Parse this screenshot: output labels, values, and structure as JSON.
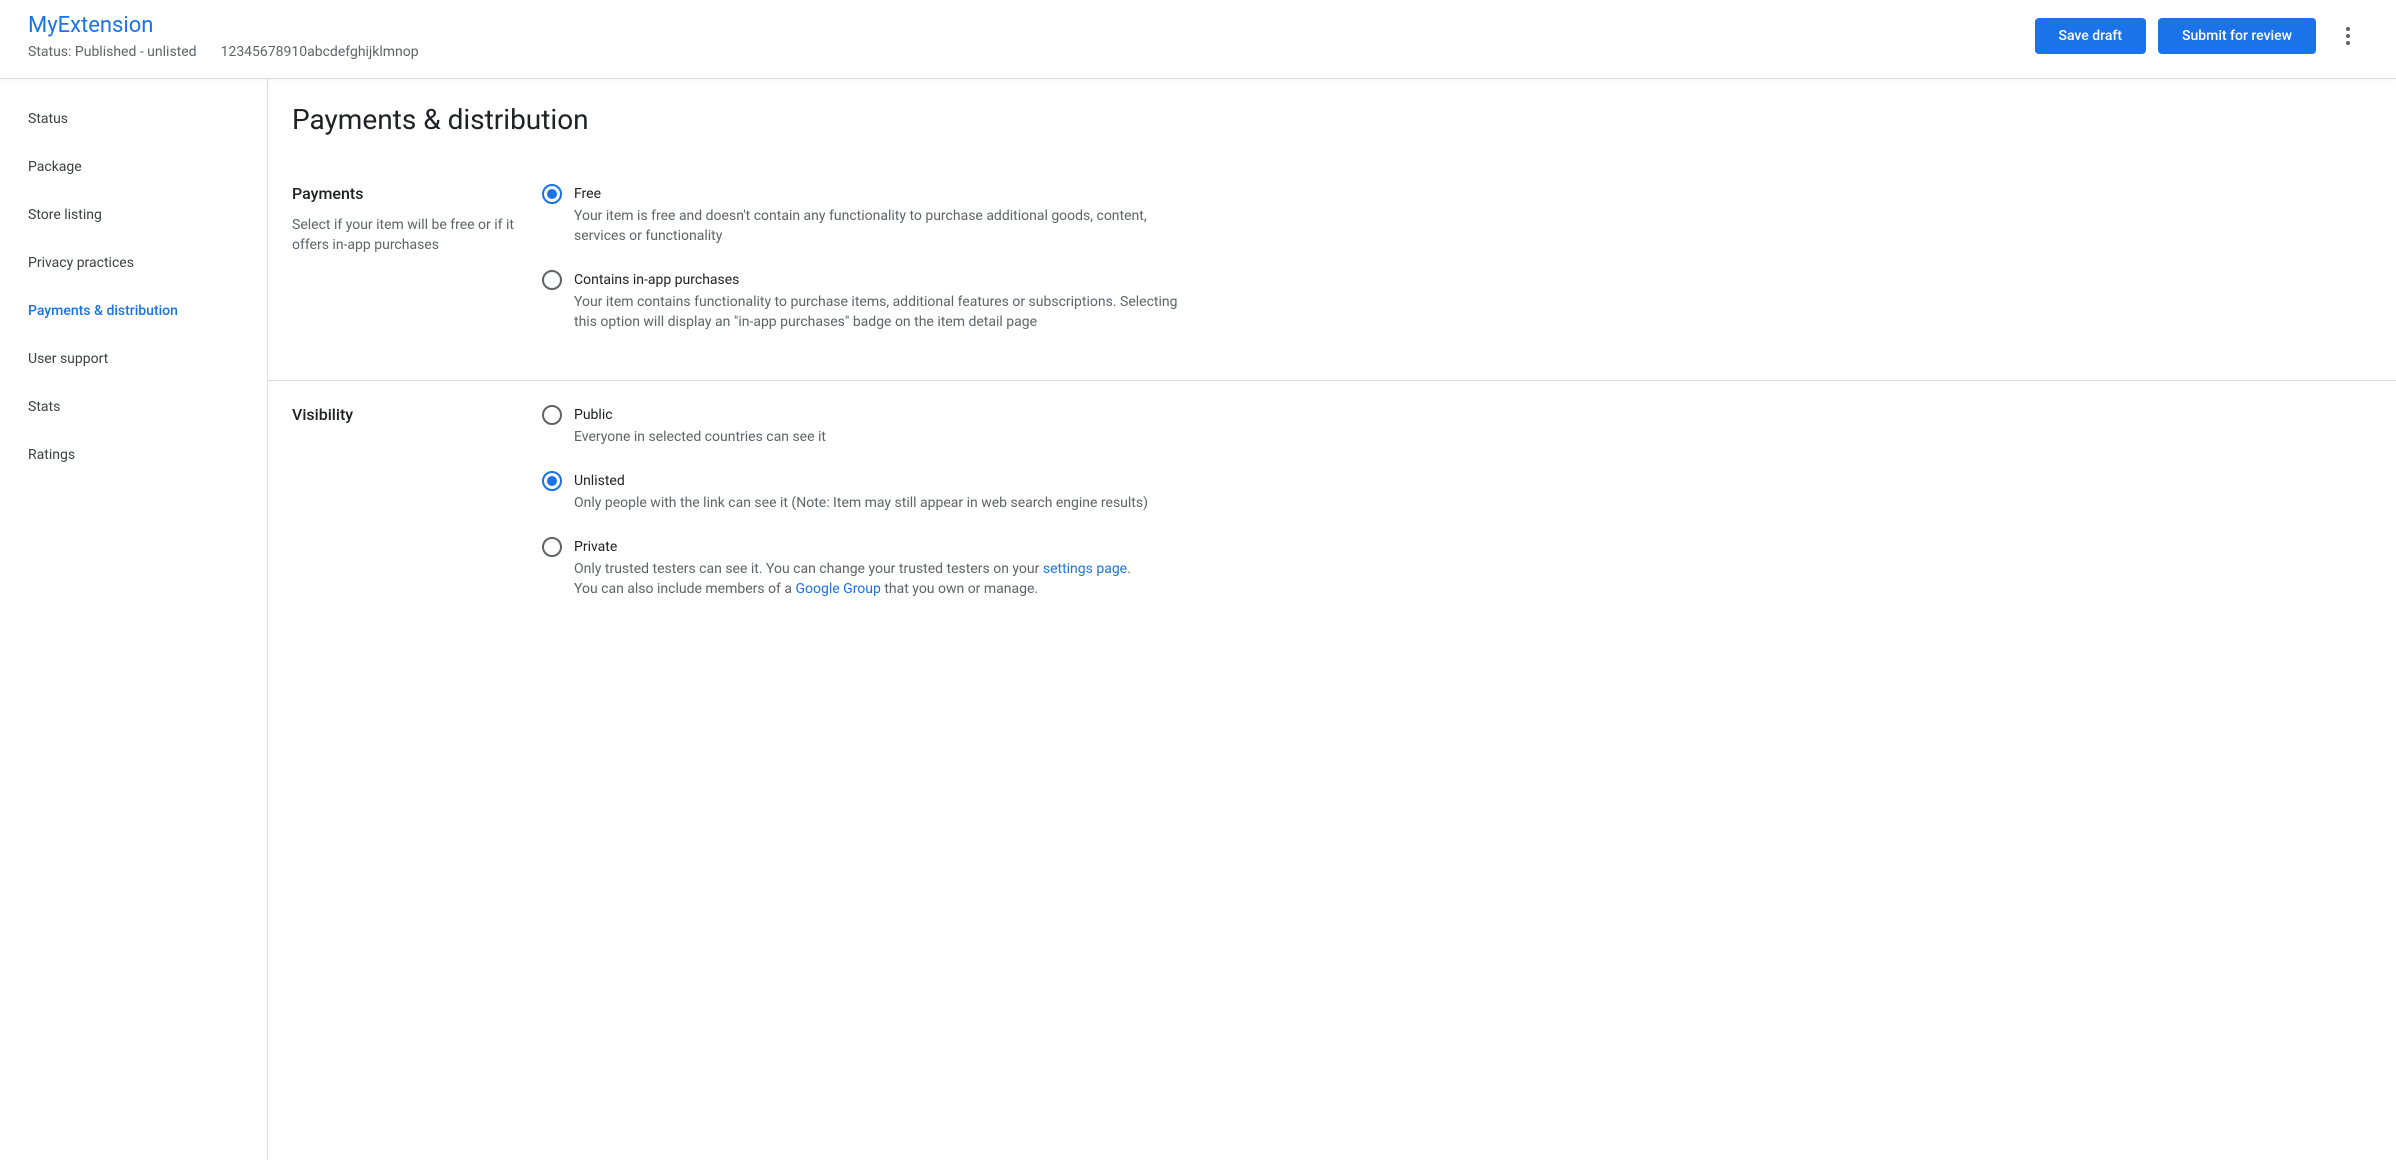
{
  "header": {
    "title": "MyExtension",
    "status": "Status: Published - unlisted",
    "itemId": "12345678910abcdefghijklmnop",
    "saveDraftLabel": "Save draft",
    "submitLabel": "Submit for review"
  },
  "sidebar": {
    "items": [
      {
        "label": "Status"
      },
      {
        "label": "Package"
      },
      {
        "label": "Store listing"
      },
      {
        "label": "Privacy practices"
      },
      {
        "label": "Payments & distribution"
      },
      {
        "label": "User support"
      },
      {
        "label": "Stats"
      },
      {
        "label": "Ratings"
      }
    ]
  },
  "page": {
    "title": "Payments & distribution"
  },
  "payments": {
    "title": "Payments",
    "desc": "Select if your item will be free or if it offers in-app purchases",
    "options": {
      "free": {
        "label": "Free",
        "desc": "Your item is free and doesn't contain any functionality to purchase additional goods, content, services or functionality"
      },
      "iap": {
        "label": "Contains in-app purchases",
        "desc": "Your item contains functionality to purchase items, additional features or subscriptions. Selecting this option will display an \"in-app purchases\" badge on the item detail page"
      }
    },
    "selected": "free"
  },
  "visibility": {
    "title": "Visibility",
    "options": {
      "public": {
        "label": "Public",
        "desc": "Everyone in selected countries can see it"
      },
      "unlisted": {
        "label": "Unlisted",
        "desc": "Only people with the link can see it (Note: Item may still appear in web search engine results)"
      },
      "private": {
        "label": "Private",
        "descPart1": "Only trusted testers can see it. You can change your trusted testers on your ",
        "settingsLink": "settings page",
        "descPart2": ".",
        "descPart3": "You can also include members of a ",
        "googleGroupLink": "Google Group",
        "descPart4": " that you own or manage."
      }
    },
    "selected": "unlisted"
  }
}
